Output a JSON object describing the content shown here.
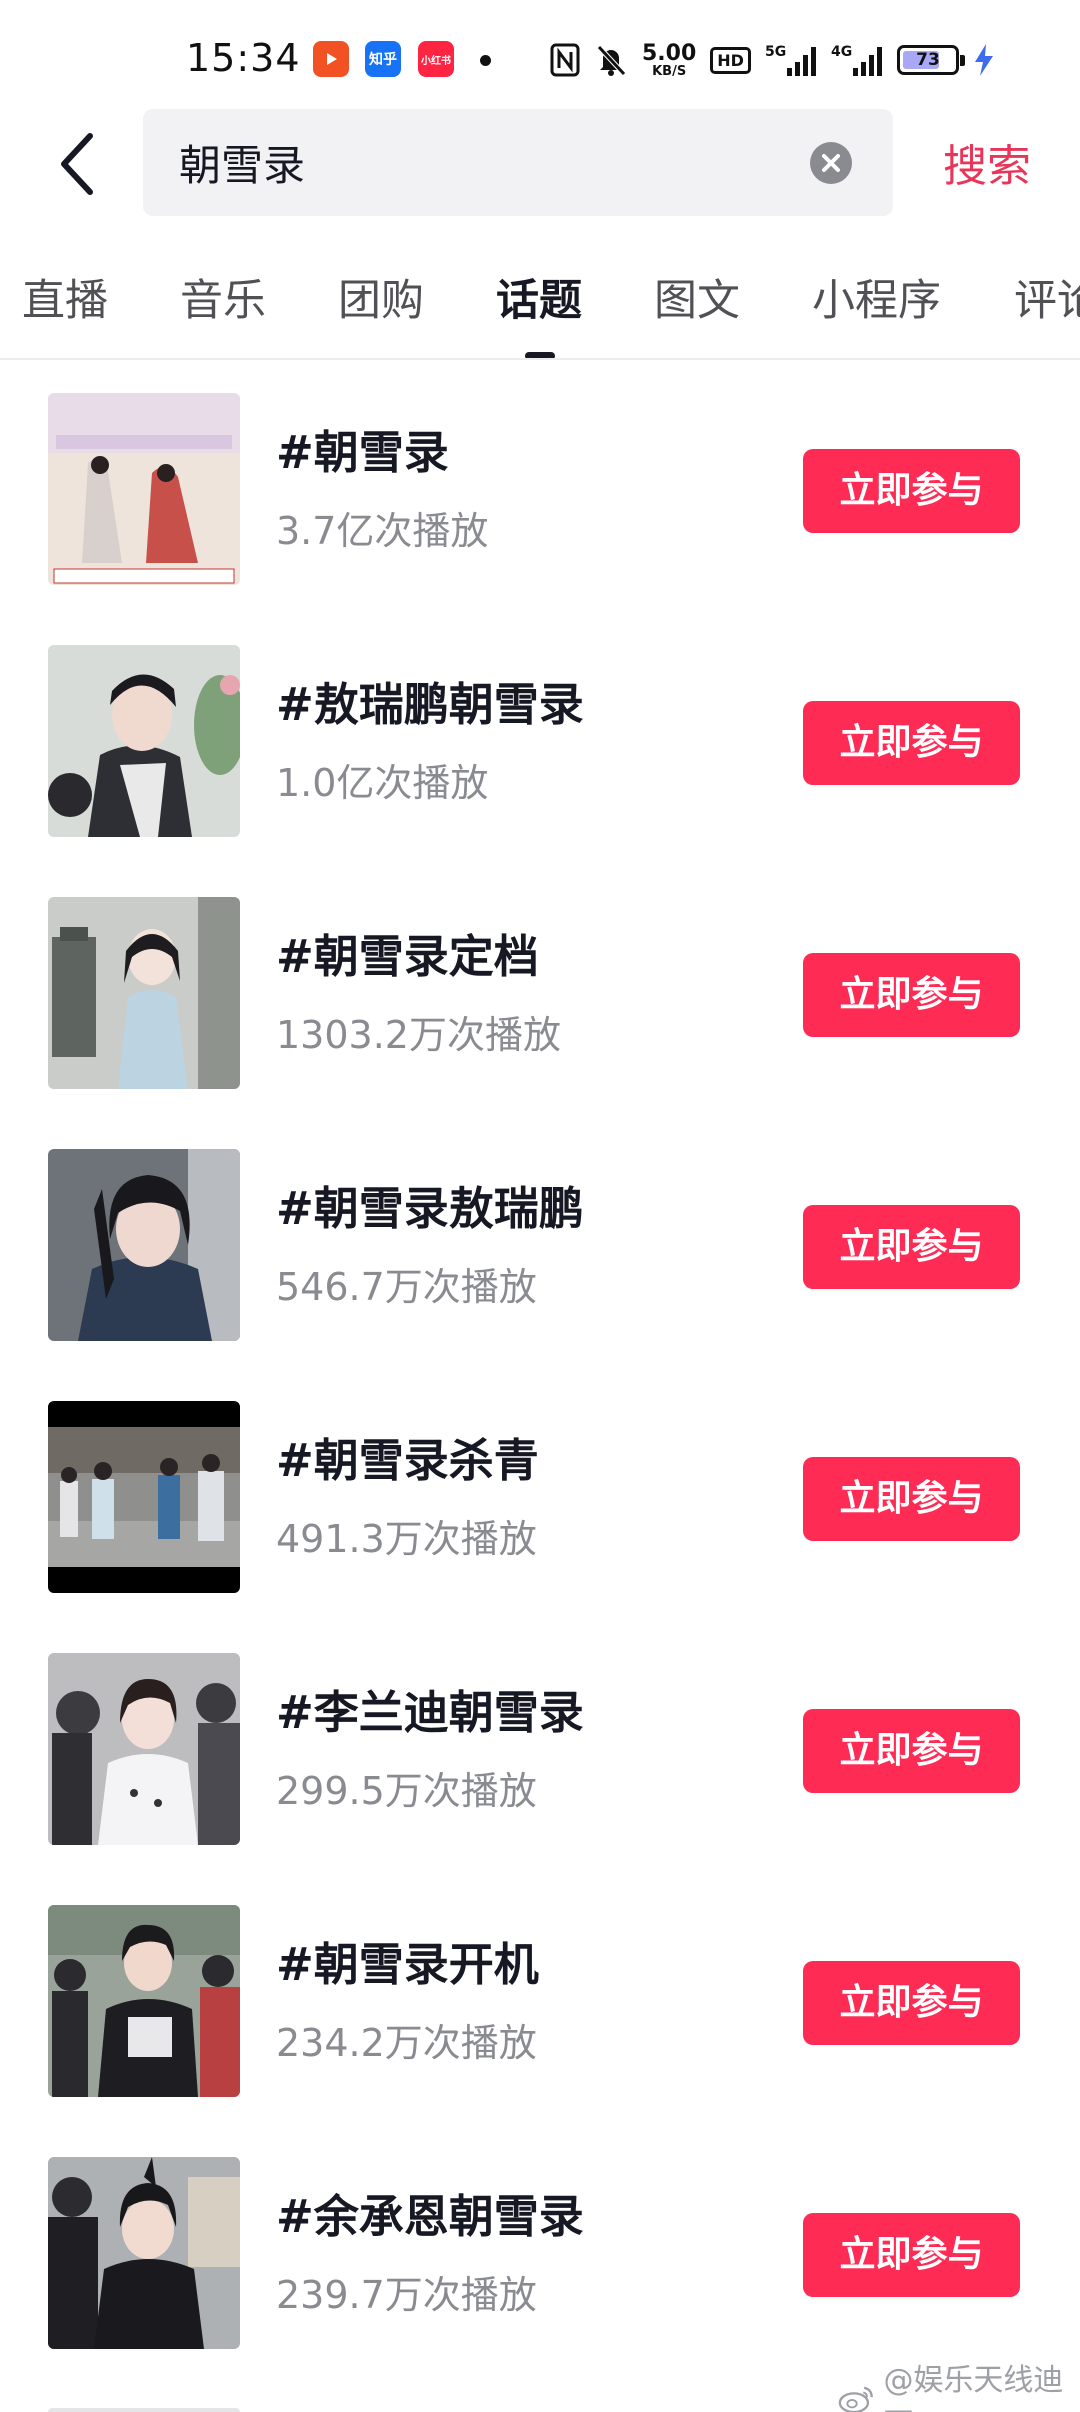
{
  "status_bar": {
    "time": "15:34",
    "apps": [
      {
        "icon": "video-app-icon",
        "label": ""
      },
      {
        "icon": "zhihu-app-icon",
        "label": "知乎"
      },
      {
        "icon": "xiaohongshu-app-icon",
        "label": "小红书"
      }
    ],
    "net_speed_value": "5.00",
    "net_speed_unit": "KB/S",
    "hd_label": "HD",
    "signal_5g": "5G",
    "signal_4g": "4G",
    "battery": "73"
  },
  "search": {
    "query": "朝雪录",
    "submit_label": "搜索"
  },
  "tabs": [
    {
      "label": "直播",
      "active": false
    },
    {
      "label": "音乐",
      "active": false
    },
    {
      "label": "团购",
      "active": false
    },
    {
      "label": "话题",
      "active": true
    },
    {
      "label": "图文",
      "active": false
    },
    {
      "label": "小程序",
      "active": false
    },
    {
      "label": "评论",
      "active": false
    }
  ],
  "results": [
    {
      "title": "#朝雪录",
      "views": "3.7亿次播放",
      "button": "立即参与"
    },
    {
      "title": "#敖瑞鹏朝雪录",
      "views": "1.0亿次播放",
      "button": "立即参与"
    },
    {
      "title": "#朝雪录定档",
      "views": "1303.2万次播放",
      "button": "立即参与"
    },
    {
      "title": "#朝雪录敖瑞鹏",
      "views": "546.7万次播放",
      "button": "立即参与"
    },
    {
      "title": "#朝雪录杀青",
      "views": "491.3万次播放",
      "button": "立即参与"
    },
    {
      "title": "#李兰迪朝雪录",
      "views": "299.5万次播放",
      "button": "立即参与"
    },
    {
      "title": "#朝雪录开机",
      "views": "234.2万次播放",
      "button": "立即参与"
    },
    {
      "title": "#余承恩朝雪录",
      "views": "239.7万次播放",
      "button": "立即参与"
    }
  ],
  "watermark": "@娱乐天线迪西",
  "colors": {
    "accent": "#fe2c55",
    "search_submit": "#e8365a",
    "muted_text": "#8a8b91",
    "primary_text": "#161823",
    "search_bg": "#f2f2f4"
  }
}
